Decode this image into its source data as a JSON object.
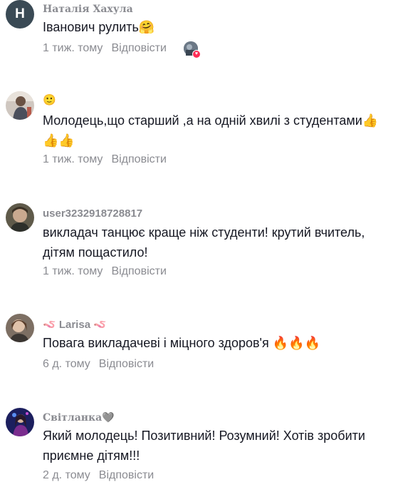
{
  "comments": [
    {
      "avatar_letter": "Н",
      "username": "Наталія Хахула",
      "text": "Іванович рулить",
      "emoji": "🤗",
      "time": "1 тиж. тому",
      "reply": "Відповісти",
      "creator_liked": true,
      "avatar_icon": "letter-avatar"
    },
    {
      "username_emoji": "🙂",
      "text": "Молодець,що старший ,а на одній хвилі з студентами👍",
      "text_line2": "👍👍",
      "time": "1 тиж. тому",
      "reply": "Відповісти",
      "avatar_icon": "photo-avatar"
    },
    {
      "username": "user3232918728817",
      "text": "викладач танцює краще ніж студенти! крутий вчитель,",
      "text_line2": "дітям пощастило!",
      "time": "1 тиж. тому",
      "reply": "Відповісти",
      "avatar_icon": "photo-avatar"
    },
    {
      "username": "🪱 Larisa 🪱",
      "text": "Повага викладачеві і міцного здоров'я 🔥🔥🔥",
      "time": "6 д. тому",
      "reply": "Відповісти",
      "avatar_icon": "photo-avatar"
    },
    {
      "username": "Світланка🩶",
      "text": "Який молодець! Позитивний! Розумний! Хотів зробити",
      "text_line2": "приємне дітям!!!",
      "time": "2 д. тому",
      "reply": "Відповісти",
      "avatar_icon": "photo-avatar"
    }
  ],
  "colors": {
    "text": "#161823",
    "muted": "#8a8b91",
    "like_heart": "#fe2c55"
  }
}
